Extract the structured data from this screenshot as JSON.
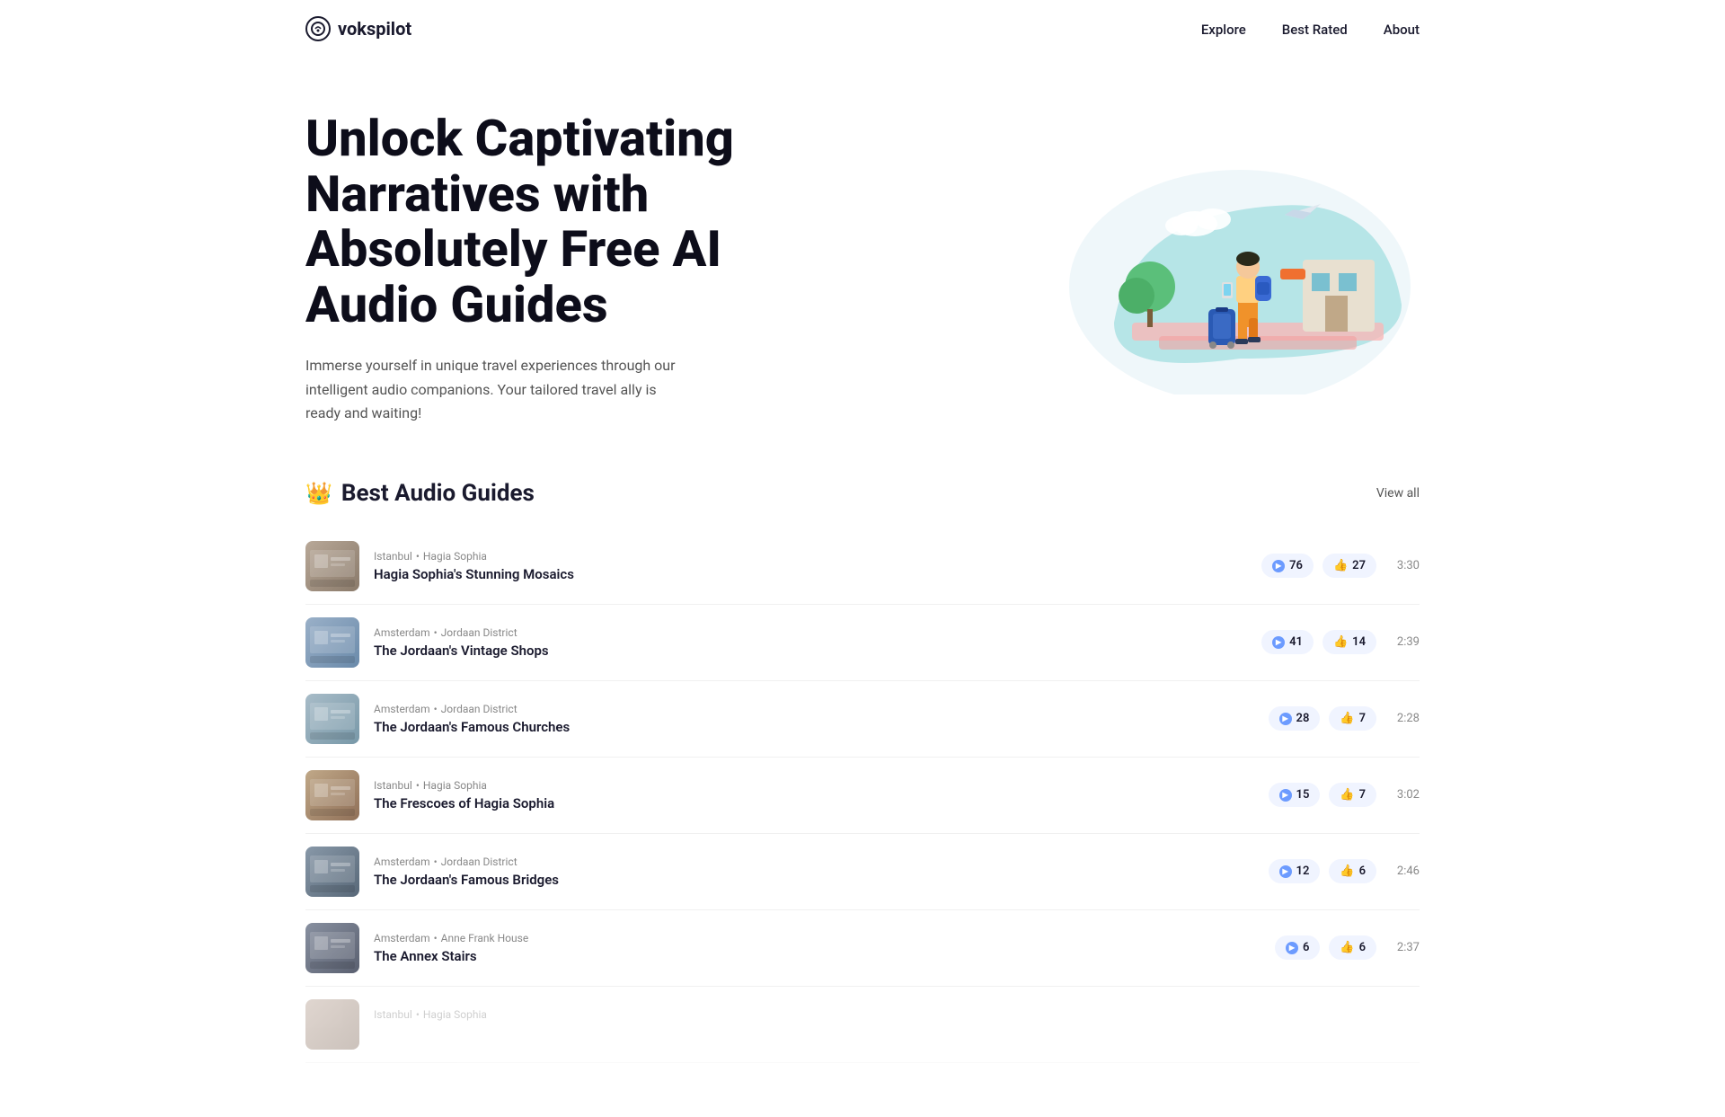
{
  "nav": {
    "logo_text": "vokspilot",
    "logo_voks": "voks",
    "logo_pilot": "pilot",
    "links": [
      {
        "label": "Explore",
        "href": "#"
      },
      {
        "label": "Best Rated",
        "href": "#"
      },
      {
        "label": "About",
        "href": "#"
      }
    ]
  },
  "hero": {
    "title": "Unlock Captivating Narratives with Absolutely Free AI Audio Guides",
    "subtitle": "Immerse yourself in unique travel experiences through our intelligent audio companions. Your tailored travel ally is ready and waiting!"
  },
  "best_section": {
    "icon": "👑",
    "title": "Best Audio Guides",
    "view_all": "View all",
    "guides": [
      {
        "city": "Istanbul",
        "district": "Hagia Sophia",
        "name": "Hagia Sophia's Stunning Mosaics",
        "plays": 76,
        "likes": 27,
        "duration": "3:30",
        "thumb_class": "thumb-hagia"
      },
      {
        "city": "Amsterdam",
        "district": "Jordaan District",
        "name": "The Jordaan's Vintage Shops",
        "plays": 41,
        "likes": 14,
        "duration": "2:39",
        "thumb_class": "thumb-amsterdam"
      },
      {
        "city": "Amsterdam",
        "district": "Jordaan District",
        "name": "The Jordaan's Famous Churches",
        "plays": 28,
        "likes": 7,
        "duration": "2:28",
        "thumb_class": "thumb-churches"
      },
      {
        "city": "Istanbul",
        "district": "Hagia Sophia",
        "name": "The Frescoes of Hagia Sophia",
        "plays": 15,
        "likes": 7,
        "duration": "3:02",
        "thumb_class": "thumb-frescoes"
      },
      {
        "city": "Amsterdam",
        "district": "Jordaan District",
        "name": "The Jordaan's Famous Bridges",
        "plays": 12,
        "likes": 6,
        "duration": "2:46",
        "thumb_class": "thumb-bridges"
      },
      {
        "city": "Amsterdam",
        "district": "Anne Frank House",
        "name": "The Annex Stairs",
        "plays": 6,
        "likes": 6,
        "duration": "2:37",
        "thumb_class": "thumb-annex"
      },
      {
        "city": "Istanbul",
        "district": "Hagia Sophia",
        "name": "",
        "plays": null,
        "likes": null,
        "duration": "",
        "thumb_class": "thumb-partial",
        "partial": true
      }
    ]
  }
}
